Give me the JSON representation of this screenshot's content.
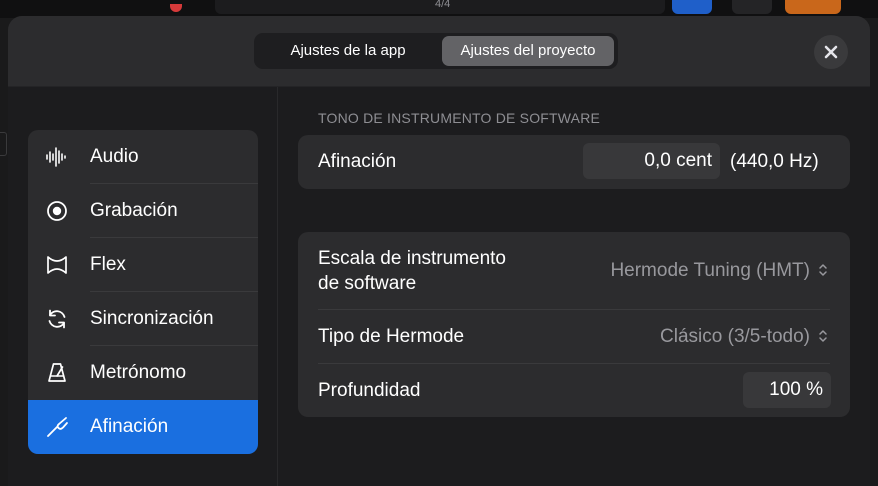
{
  "background": {
    "timesig": "4/4"
  },
  "header": {
    "tabs": [
      {
        "label": "Ajustes de la app",
        "selected": false
      },
      {
        "label": "Ajustes del proyecto",
        "selected": true
      }
    ],
    "close_icon": "close-icon"
  },
  "sidebar": {
    "items": [
      {
        "label": "Audio",
        "icon": "waveform-icon",
        "selected": false
      },
      {
        "label": "Grabación",
        "icon": "record-icon",
        "selected": false
      },
      {
        "label": "Flex",
        "icon": "flex-icon",
        "selected": false
      },
      {
        "label": "Sincronización",
        "icon": "sync-icon",
        "selected": false
      },
      {
        "label": "Metrónomo",
        "icon": "metronome-icon",
        "selected": false
      },
      {
        "label": "Afinación",
        "icon": "tuning-fork-icon",
        "selected": true
      }
    ]
  },
  "main": {
    "section_title": "TONO DE INSTRUMENTO DE SOFTWARE",
    "tuning": {
      "label": "Afinación",
      "value": "0,0 cent",
      "hz": "(440,0 Hz)"
    },
    "scale": {
      "label_line1": "Escala de instrumento",
      "label_line2": "de software",
      "value": "Hermode Tuning (HMT)"
    },
    "hermode_type": {
      "label": "Tipo de Hermode",
      "value": "Clásico (3/5-todo)"
    },
    "depth": {
      "label": "Profundidad",
      "value": "100 %"
    }
  },
  "colors": {
    "accent": "#1a6fe0",
    "panel": "#2c2c2e",
    "secondary_text": "#98989d",
    "section_text": "#8e8e93"
  }
}
